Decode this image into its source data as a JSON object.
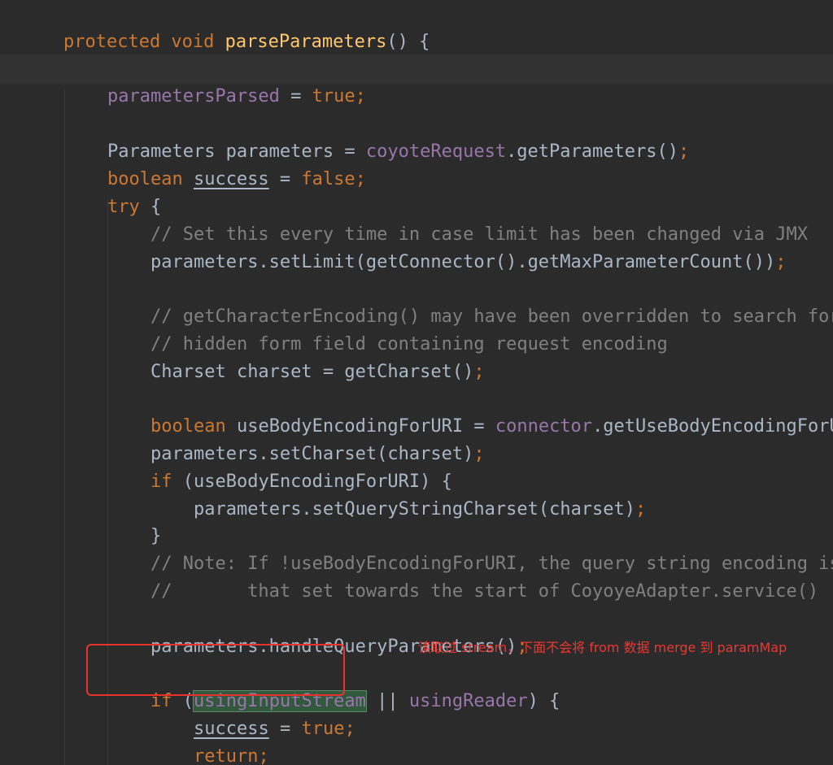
{
  "editor": {
    "lines": {
      "l1": {
        "kw": "protected void ",
        "method": "parseParameters",
        "rest": "() {"
      },
      "l2": {
        "field": "parametersParsed",
        "eq": " = ",
        "kw": "true",
        "semi": ";"
      },
      "l3": {
        "plain1": "Parameters parameters = ",
        "field": "coyoteRequest",
        "plain2": ".getParameters()",
        "semi": ";"
      },
      "l4": {
        "kw1": "boolean ",
        "var": "success",
        "eq": " = ",
        "kw2": "false",
        "semi": ";"
      },
      "l5": {
        "kw": "try",
        "rest": " {"
      },
      "l6": {
        "cmt": "// Set this every time in case limit has been changed via JMX"
      },
      "l7": {
        "plain": "parameters.setLimit(getConnector().getMaxParameterCount())",
        "semi": ";"
      },
      "l8": {
        "cmt": "// getCharacterEncoding() may have been overridden to search for"
      },
      "l9": {
        "cmt": "// hidden form field containing request encoding"
      },
      "l10": {
        "plain": "Charset charset = getCharset()",
        "semi": ";"
      },
      "l11": {
        "kw": "boolean ",
        "plain1": "useBodyEncodingForURI = ",
        "field": "connector",
        "plain2": ".getUseBodyEncodingForURI("
      },
      "l12": {
        "plain": "parameters.setCharset(charset)",
        "semi": ";"
      },
      "l13": {
        "kw": "if ",
        "rest": "(useBodyEncodingForURI) {"
      },
      "l14": {
        "plain": "parameters.setQueryStringCharset(charset)",
        "semi": ";"
      },
      "l15": {
        "plain": "}"
      },
      "l16": {
        "cmt": "// Note: If !useBodyEncodingForURI, the query string encoding is"
      },
      "l17": {
        "cmt": "//       that set towards the start of CoyoyeAdapter.service()"
      },
      "l18": {
        "plain": "parameters.handleQueryParameters()",
        "semi": ";"
      },
      "l19": {
        "kw": "if ",
        "paren": "(",
        "hl": "usingInputStream",
        "op": " || ",
        "field": "usingReader",
        "rest": ") {"
      },
      "l20": {
        "var": "success",
        "eq": " = ",
        "kw": "true",
        "semi": ";"
      },
      "l21": {
        "kw": "return",
        "semi": ";"
      },
      "l22": {
        "plain": "}"
      }
    }
  },
  "annotation": {
    "text": "读取过 stream，下面不会将 from 数据 merge 到 paramMap"
  },
  "colors": {
    "background": "#2b2b2b",
    "keyword": "#cc7832",
    "field": "#9876aa",
    "method": "#ffc66d",
    "comment": "#808080",
    "text": "#a9b7c6",
    "annotation": "#f0352f"
  }
}
